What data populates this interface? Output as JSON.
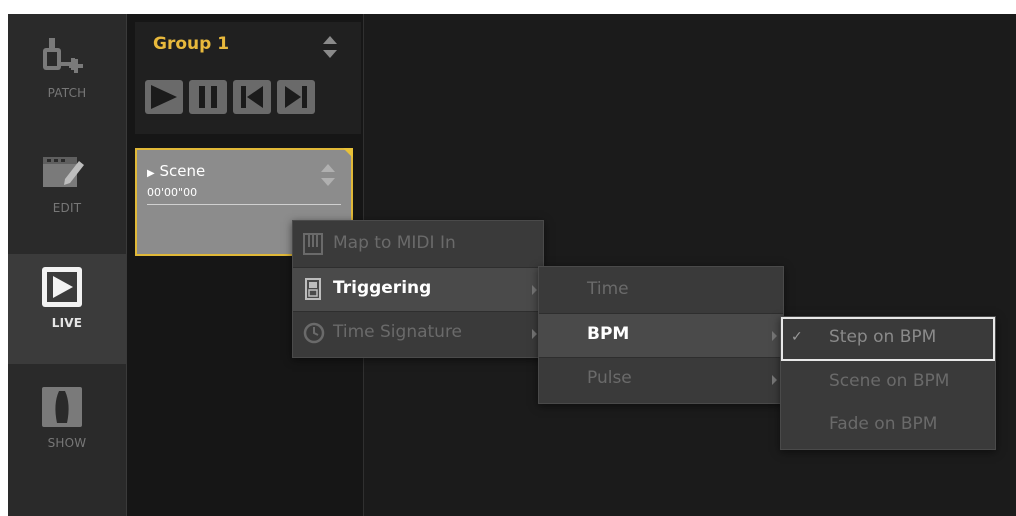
{
  "nav": {
    "items": [
      {
        "label": "PATCH",
        "icon": "patch-icon"
      },
      {
        "label": "EDIT",
        "icon": "edit-icon"
      },
      {
        "label": "LIVE",
        "icon": "live-icon",
        "active": true
      },
      {
        "label": "SHOW",
        "icon": "show-icon"
      }
    ]
  },
  "group": {
    "title": "Group 1",
    "transport": [
      "play-icon",
      "pause-icon",
      "previous-icon",
      "next-icon"
    ]
  },
  "scene": {
    "name": "Scene",
    "time": "00'00\"00"
  },
  "context_menu": {
    "items": [
      {
        "label": "Map to MIDI In",
        "icon": "midi-piano-icon",
        "enabled": false
      },
      {
        "label": "Triggering",
        "icon": "trigger-icon",
        "enabled": true,
        "submenu": true
      },
      {
        "label": "Time Signature",
        "icon": "clock-icon",
        "enabled": false,
        "submenu": true
      }
    ]
  },
  "triggering_menu": {
    "items": [
      {
        "label": "Time",
        "enabled": false
      },
      {
        "label": "BPM",
        "enabled": true,
        "submenu": true
      },
      {
        "label": "Pulse",
        "enabled": false,
        "submenu": true
      }
    ]
  },
  "bpm_menu": {
    "items": [
      {
        "label": "Step on BPM",
        "checked": true
      },
      {
        "label": "Scene on BPM",
        "checked": false
      },
      {
        "label": "Fade on BPM",
        "checked": false
      }
    ],
    "check_glyph": "✓"
  },
  "colors": {
    "accent": "#e8b93c",
    "background": "#1b1b1b",
    "menu": "#3a3a3a"
  }
}
